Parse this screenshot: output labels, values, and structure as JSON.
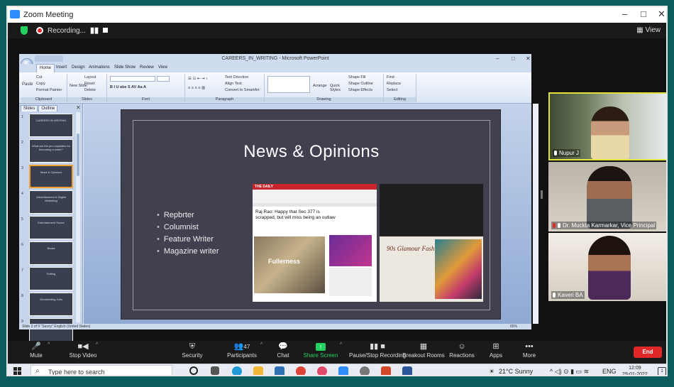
{
  "window": {
    "title": "Zoom Meeting",
    "minimize": "–",
    "maximize": "□",
    "close": "✕"
  },
  "meeting_top": {
    "recording_label": "Recording...",
    "pause_glyph": "▮▮",
    "view_label": "▦ View"
  },
  "powerpoint": {
    "title": "CAREERS_IN_WRITING - Microsoft PowerPoint",
    "tabs": [
      "Home",
      "Insert",
      "Design",
      "Animations",
      "Slide Show",
      "Review",
      "View"
    ],
    "ribbon_groups": [
      "Clipboard",
      "Slides",
      "Font",
      "Paragraph",
      "Drawing",
      "Editing"
    ],
    "ribbon_items": {
      "paste": "Paste",
      "cut": "Cut",
      "copy": "Copy",
      "format_painter": "Format Painter",
      "new_slide": "New Slide",
      "layout": "Layout",
      "reset": "Reset",
      "delete": "Delete",
      "text_direction": "Text Direction",
      "align_text": "Align Text",
      "convert_smartart": "Convert to SmartArt",
      "arrange": "Arrange",
      "quick_styles": "Quick Styles",
      "shape_fill": "Shape Fill",
      "shape_outline": "Shape Outline",
      "shape_effects": "Shape Effects",
      "find": "Find",
      "replace": "Replace",
      "select": "Select"
    },
    "pane_tabs": [
      "Slides",
      "Outline"
    ],
    "thumbnails": [
      {
        "num": "1",
        "text": "CAREERS IN WRITING"
      },
      {
        "num": "2",
        "text": "What are the pre-requisites for becoming a writer?"
      },
      {
        "num": "3",
        "text": "News & Opinions"
      },
      {
        "num": "4",
        "text": "Advertisement & Digital Marketing"
      },
      {
        "num": "5",
        "text": "Entertainment Sector"
      },
      {
        "num": "6",
        "text": "Books"
      },
      {
        "num": "7",
        "text": "Editing"
      },
      {
        "num": "8",
        "text": "Ghostwriting Jobs"
      },
      {
        "num": "9",
        "text": "Writing Tips"
      }
    ],
    "slide": {
      "title": "News & Opinions",
      "bullets": [
        "Repbrter",
        "Columnist",
        "Feature Writer",
        "Magazine writer"
      ],
      "news_headline": "Raj Rao: Happy that Sec 377 is scrapped, but will miss being an outlaw",
      "news_caption": "Fullerness",
      "magazine_title": "90s Glamour Fashion On The Rise"
    },
    "status": {
      "left": "Slide 3 of 9   \"Savoy\"   English (United States)",
      "zoom": "65%"
    }
  },
  "participants": [
    {
      "name": "Nupur J",
      "active_speaker": true
    },
    {
      "name": "Dr. Muckta Karmarkar, Vice Principal",
      "active_speaker": false
    },
    {
      "name": "Kaveri BA",
      "active_speaker": false
    }
  ],
  "toolbar": {
    "mute": "Mute",
    "stop_video": "Stop Video",
    "security": "Security",
    "participants": "Participants",
    "participants_count": "47",
    "chat": "Chat",
    "share_screen": "Share Screen",
    "pause_recording": "Pause/Stop Recording",
    "breakout_rooms": "Breakout Rooms",
    "reactions": "Reactions",
    "apps": "Apps",
    "more": "More",
    "end": "End"
  },
  "taskbar": {
    "search_placeholder": "Type here to search",
    "weather": "21°C  Sunny",
    "language": "ENG",
    "time": "12:09",
    "date": "29-01-2022",
    "notifications": "1"
  },
  "colors": {
    "accent_green": "#23d160",
    "end_red": "#e02828",
    "speaker_yellow": "#e2e23a",
    "frame_teal": "#0b5d5d"
  }
}
